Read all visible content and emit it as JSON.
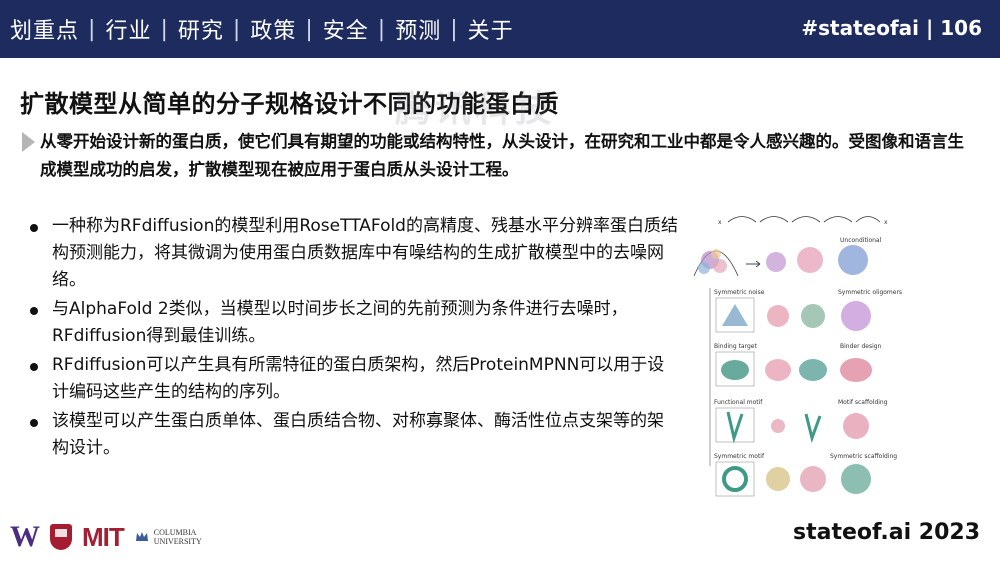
{
  "nav": {
    "items": [
      "划重点",
      "行业",
      "研究",
      "政策",
      "安全",
      "预测",
      "关于"
    ],
    "separator": "|"
  },
  "slide_tag": "#stateofai | 106",
  "title": "扩散模型从简单的分子规格设计不同的功能蛋白质",
  "watermark": "腾讯科技",
  "lead": "从零开始设计新的蛋白质，使它们具有期望的功能或结构特性，从头设计，在研究和工业中都是令人感兴趣的。受图像和语言生成模型成功的启发，扩散模型现在被应用于蛋白质从头设计工程。",
  "bullets": [
    "一种称为RFdiffusion的模型利用RoseTTAFold的高精度、残基水平分辨率蛋白质结构预测能力，将其微调为使用蛋白质数据库中有噪结构的生成扩散模型中的去噪网络。",
    "与AlphaFold 2类似，当模型以时间步长之间的先前预测为条件进行去噪时，RFdiffusion得到最佳训练。",
    "RFdiffusion可以产生具有所需特征的蛋白质架构，然后ProteinMPNN可以用于设计编码这些产生的结构的序列。",
    "该模型可以产生蛋白质单体、蛋白质结合物、对称寡聚体、酶活性位点支架等的架构设计。"
  ],
  "figure": {
    "x_start": "x",
    "x_end": "x",
    "labels": {
      "unconditional": "Unconditional",
      "symmetric_noise": "Symmetric noise",
      "symmetric_oligomers": "Symmetric oligomers",
      "binding_target": "Binding target",
      "binder_design": "Binder design",
      "functional_motif": "Functional motif",
      "motif_scaffolding": "Motif scaffolding",
      "symmetric_motif": "Symmetric motif",
      "symmetric_scaffolding": "Symmetric scaffolding"
    }
  },
  "logos": {
    "uw": "W",
    "mit": "MIT",
    "columbia_line1": "COLUMBIA",
    "columbia_line2": "UNIVERSITY"
  },
  "footer_brand": "stateof.ai 2023",
  "colors": {
    "topbar": "#1d2b5e",
    "uw_purple": "#4b2e83",
    "harvard_crimson": "#a51c30",
    "mit_red": "#a31f34"
  }
}
